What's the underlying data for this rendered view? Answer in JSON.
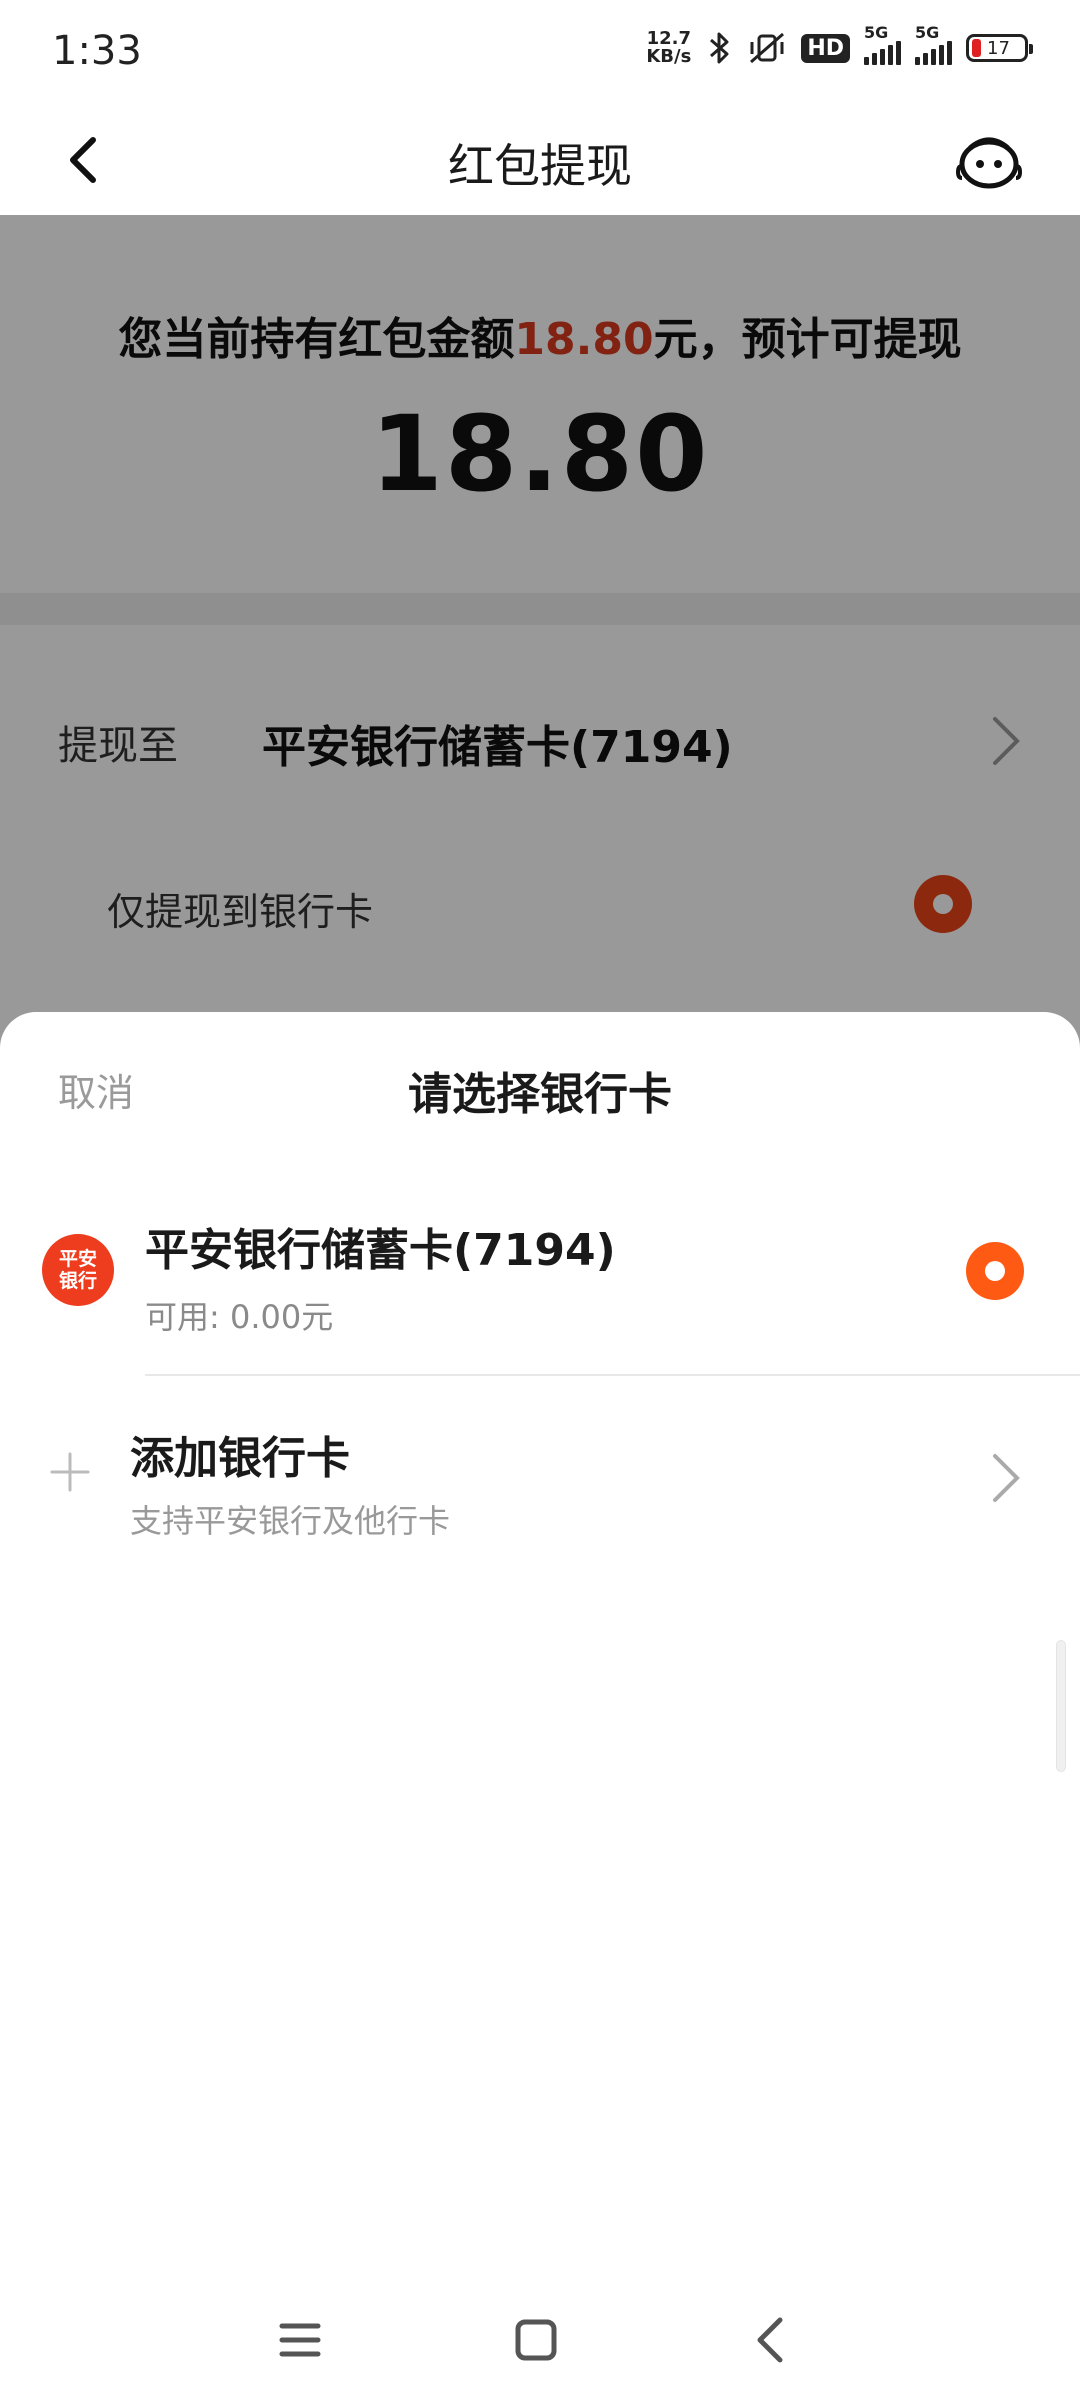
{
  "status_bar": {
    "time": "1:33",
    "net_speed_value": "12.7",
    "net_speed_unit": "KB/s",
    "hd_label": "HD",
    "sim1_label": "5G",
    "sim2_label": "5G",
    "battery_level": "17"
  },
  "header": {
    "title": "红包提现"
  },
  "summary": {
    "text_before": "您当前持有红包金额",
    "amount": "18.80",
    "text_after": "元，预计可提现",
    "withdrawable": "18.80"
  },
  "withdraw_to": {
    "label": "提现至",
    "bank": "平安银行储蓄卡(7194)",
    "only_bank_label": "仅提现到银行卡"
  },
  "sheet": {
    "cancel_label": "取消",
    "title": "请选择银行卡",
    "bank_card": {
      "logo_line1": "平安",
      "logo_line2": "银行",
      "name": "平安银行储蓄卡(7194)",
      "available": "可用:  0.00元"
    },
    "add_card": {
      "title": "添加银行卡",
      "subtitle": "支持平安银行及他行卡"
    }
  },
  "colors": {
    "accent": "#ff5a14",
    "amount_red": "#d83a1e",
    "overlay": "rgba(0,0,0,0.4)"
  }
}
